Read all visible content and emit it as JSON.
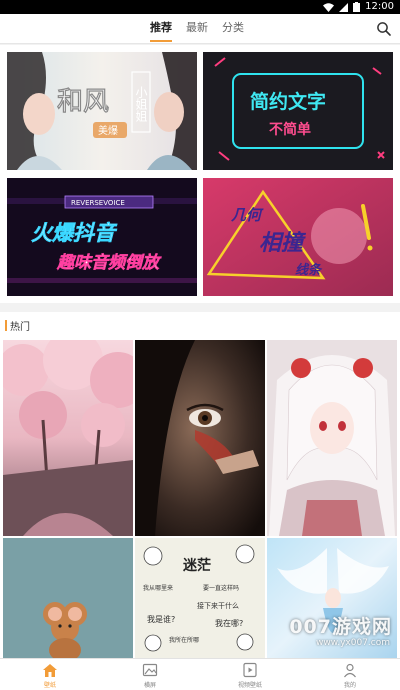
{
  "status_bar": {
    "time": "12:00"
  },
  "nav": {
    "tabs": [
      {
        "label": "推荐",
        "active": true
      },
      {
        "label": "最新",
        "active": false
      },
      {
        "label": "分类",
        "active": false
      }
    ],
    "accent_color": "#f29c38"
  },
  "featured": [
    {
      "line1": "和风",
      "line2": "小姐姐",
      "badge": "美爆"
    },
    {
      "line1": "简约文字",
      "line2": "不简单"
    },
    {
      "tag": "REVERSEVOICE",
      "line1": "火爆抖音",
      "line2": "趣味音频倒放"
    },
    {
      "line1": "几何",
      "line2": "相撞",
      "line3": "线条"
    }
  ],
  "hot": {
    "title": "热门",
    "items": [
      {
        "subject": "cherry-blossom"
      },
      {
        "subject": "portrait-closeup"
      },
      {
        "subject": "anime-girl"
      },
      {
        "subject": "cartoon-mouse"
      },
      {
        "subject": "meme-sticker",
        "title": "迷茫",
        "lines": [
          "我从哪里来",
          "要一直这样吗",
          "接下来干什么",
          "我是谁?",
          "我在哪?",
          "我所在所哪"
        ]
      },
      {
        "subject": "fairy-illustration"
      }
    ]
  },
  "watermark": {
    "text": "007游戏网",
    "url": "www.yx007.com"
  },
  "bottom_nav": [
    {
      "label": "壁纸",
      "icon": "home-icon",
      "active": true
    },
    {
      "label": "横屏",
      "icon": "image-icon",
      "active": false
    },
    {
      "label": "视频壁纸",
      "icon": "video-icon",
      "active": false
    },
    {
      "label": "我的",
      "icon": "user-icon",
      "active": false
    }
  ]
}
